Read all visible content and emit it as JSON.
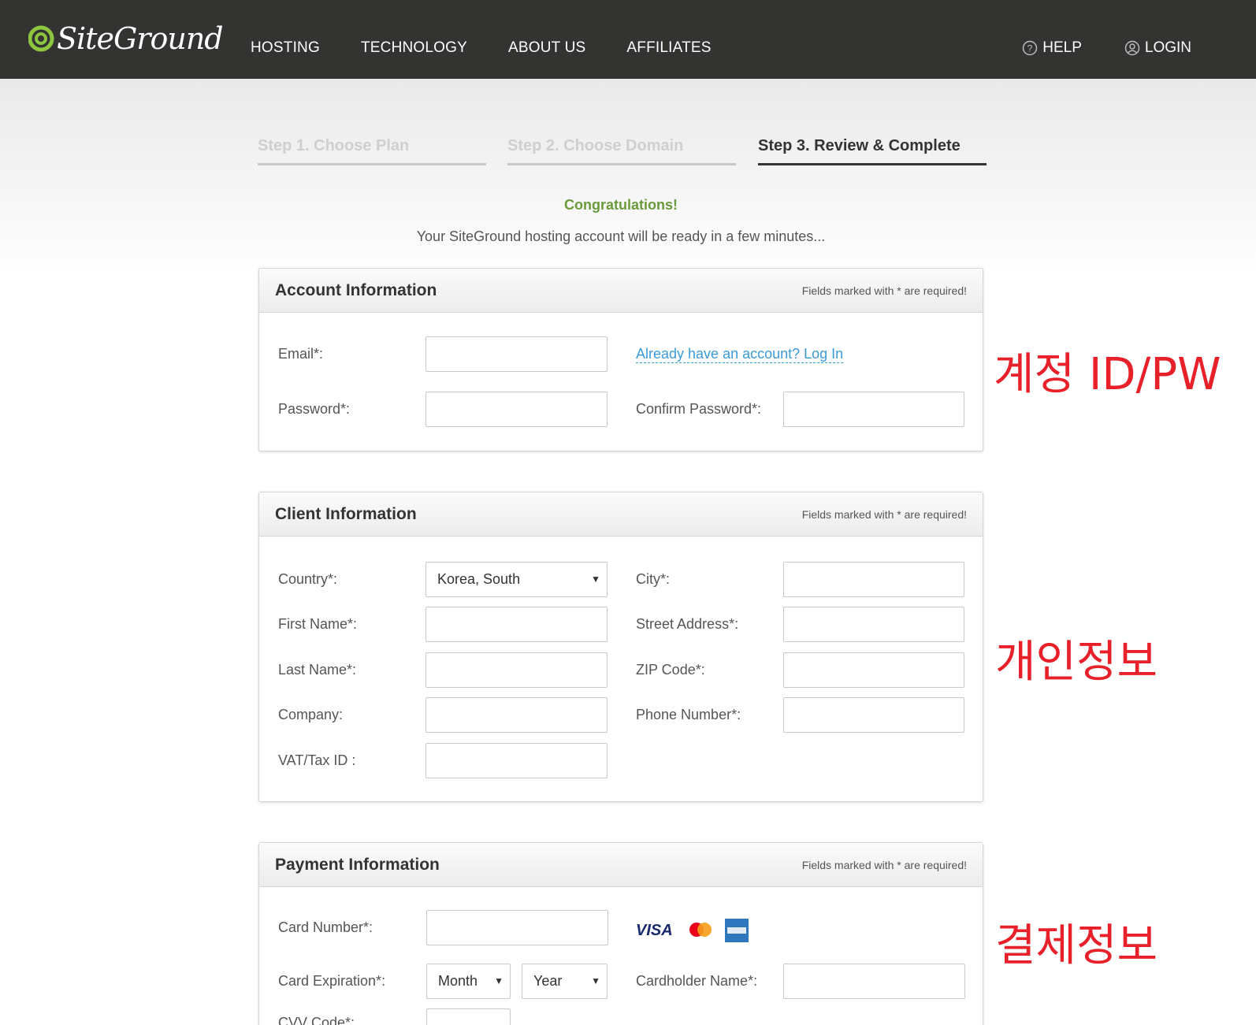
{
  "header": {
    "logo": "SiteGround",
    "nav": [
      "HOSTING",
      "TECHNOLOGY",
      "ABOUT US",
      "AFFILIATES"
    ],
    "help": "HELP",
    "login": "LOGIN"
  },
  "steps": [
    {
      "label": "Step 1. Choose Plan",
      "active": false
    },
    {
      "label": "Step 2. Choose Domain",
      "active": false
    },
    {
      "label": "Step 3. Review & Complete",
      "active": true
    }
  ],
  "congrats": "Congratulations!",
  "subtitle": "Your SiteGround hosting account will be ready in a few minutes...",
  "required_note": "Fields marked with * are required!",
  "account": {
    "title": "Account Information",
    "email_label": "Email*:",
    "login_link": "Already have an account? Log In",
    "password_label": "Password*:",
    "confirm_label": "Confirm Password*:"
  },
  "client": {
    "title": "Client Information",
    "country_label": "Country*:",
    "country_value": "Korea, South",
    "city_label": "City*:",
    "first_name_label": "First Name*:",
    "street_label": "Street Address*:",
    "last_name_label": "Last Name*:",
    "zip_label": "ZIP Code*:",
    "company_label": "Company:",
    "phone_label": "Phone Number*:",
    "vat_label": "VAT/Tax ID :"
  },
  "payment": {
    "title": "Payment Information",
    "card_number_label": "Card Number*:",
    "card_exp_label": "Card Expiration*:",
    "month_value": "Month",
    "year_value": "Year",
    "cardholder_label": "Cardholder Name*:",
    "cvv_label": "CVV Code*:",
    "visa": "VISA"
  },
  "annotations": {
    "account": "계정 ID/PW",
    "client": "개인정보",
    "payment": "결제정보"
  },
  "colors": {
    "header_bg": "#333331",
    "congrats": "#6a9a3a",
    "link": "#3a9bd9",
    "annotation": "#e8202a",
    "logo_green": "#8cc63f"
  }
}
